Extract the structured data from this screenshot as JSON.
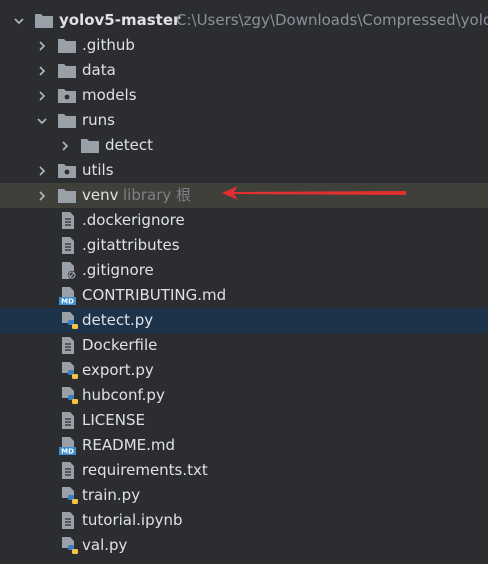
{
  "project": {
    "name": "yolov5-master",
    "path": "C:\\Users\\zgy\\Downloads\\Compressed\\yolo"
  },
  "items": [
    {
      "label": ".github",
      "hint": ""
    },
    {
      "label": "data",
      "hint": ""
    },
    {
      "label": "models",
      "hint": ""
    },
    {
      "label": "runs",
      "hint": ""
    },
    {
      "label": "detect",
      "hint": ""
    },
    {
      "label": "utils",
      "hint": ""
    },
    {
      "label": "venv",
      "hint": "library 根"
    },
    {
      "label": ".dockerignore",
      "hint": ""
    },
    {
      "label": ".gitattributes",
      "hint": ""
    },
    {
      "label": ".gitignore",
      "hint": ""
    },
    {
      "label": "CONTRIBUTING.md",
      "hint": ""
    },
    {
      "label": "detect.py",
      "hint": ""
    },
    {
      "label": "Dockerfile",
      "hint": ""
    },
    {
      "label": "export.py",
      "hint": ""
    },
    {
      "label": "hubconf.py",
      "hint": ""
    },
    {
      "label": "LICENSE",
      "hint": ""
    },
    {
      "label": "README.md",
      "hint": ""
    },
    {
      "label": "requirements.txt",
      "hint": ""
    },
    {
      "label": "train.py",
      "hint": ""
    },
    {
      "label": "tutorial.ipynb",
      "hint": ""
    },
    {
      "label": "val.py",
      "hint": ""
    }
  ],
  "icon_badges": {
    "markdown": "MD"
  },
  "colors": {
    "background": "#2b2d30",
    "selected_row": "#1c334a",
    "venv_row": "#40403a",
    "annotation_arrow": "#e03030",
    "folder": "#9aa0a8",
    "python_blue": "#3b7bbf",
    "python_yellow": "#f5c542",
    "markdown_badge": "#3d8fd1"
  }
}
